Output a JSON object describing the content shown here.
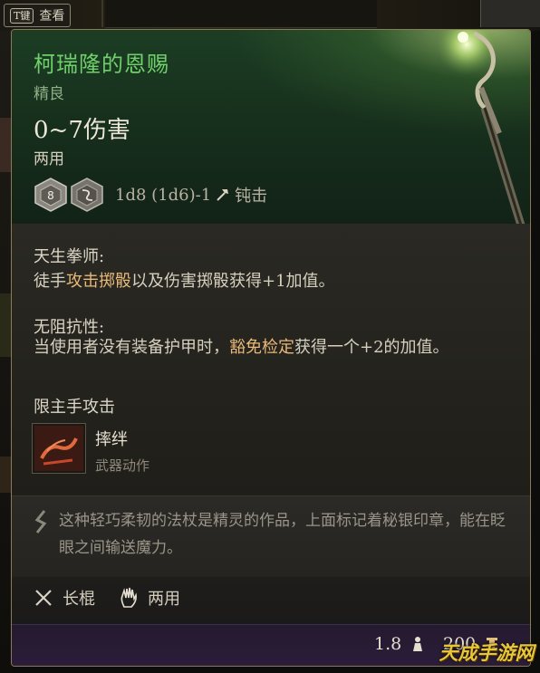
{
  "topbar": {
    "key": "T键",
    "label": "查看"
  },
  "item": {
    "name": "柯瑞隆的恩赐",
    "rarity": "精良",
    "damage": "0~7伤害",
    "handedness": "两用",
    "dice_face_1": "8",
    "dice_text": "1d8 (1d6)-1",
    "damage_type": "钝击"
  },
  "traits": [
    {
      "title": "天生拳师:",
      "text_pre": "徒手",
      "text_hl": "攻击掷骰",
      "text_post": "以及伤害掷骰获得+1加值。"
    },
    {
      "title": "无阻抗性:",
      "text_pre": "当使用者没有装备护甲时，",
      "text_hl": "豁免检定",
      "text_post": "获得一个+2的加值。"
    }
  ],
  "restriction": "限主手攻击",
  "action": {
    "name": "摔绊",
    "type": "武器动作"
  },
  "flavor": "这种轻巧柔韧的法杖是精灵的作品，上面标记着秘银印章，能在眨眼之间输送魔力。",
  "properties": {
    "weapon_class": "长棍",
    "handedness": "两用"
  },
  "footer": {
    "weight": "1.8",
    "price": "200"
  },
  "watermark": "天成手游网",
  "colors": {
    "title_green": "#6fd06a",
    "highlight": "#e8b978",
    "footer_purple": "#2b1d3a"
  },
  "icons": [
    "dice-icon",
    "hammer-icon",
    "trip-action-icon",
    "quill-icon",
    "staff-icon",
    "hand-icon",
    "weight-icon",
    "coin-icon"
  ]
}
